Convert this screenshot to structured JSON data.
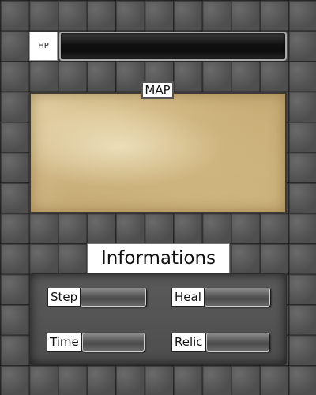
{
  "hud": {
    "hp_label": "HP",
    "hp_fill_fraction": 0
  },
  "map": {
    "label": "MAP"
  },
  "info": {
    "title": "Informations",
    "stats": {
      "step": "Step",
      "heal": "Heal",
      "time": "Time",
      "relic": "Relic"
    }
  },
  "colors": {
    "hp_fill": "#cc3333",
    "parchment": "#d8c08c",
    "stone": "#5b5b5b"
  }
}
